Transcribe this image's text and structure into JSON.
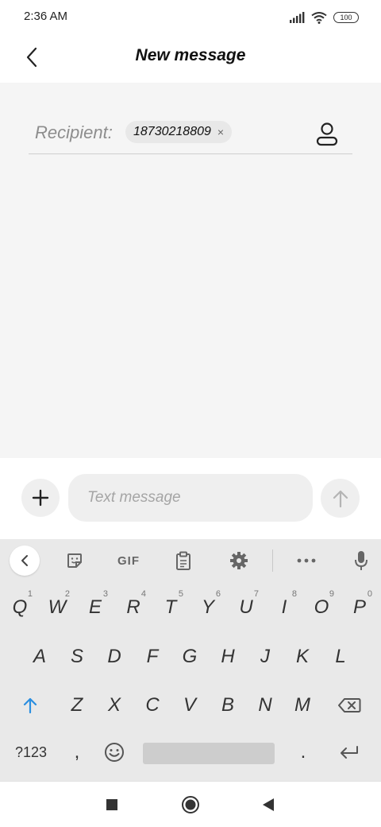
{
  "status_bar": {
    "time": "2:36 AM",
    "battery": "100",
    "icons": [
      "signal-icon",
      "wifi-icon",
      "battery-icon"
    ]
  },
  "header": {
    "title": "New message",
    "back_icon": "chevron-left-icon"
  },
  "recipient": {
    "label": "Recipient:",
    "chip_value": "18730218809",
    "chip_remove": "×",
    "contact_icon": "person-icon"
  },
  "compose": {
    "placeholder": "Text message",
    "add_icon": "plus-icon",
    "send_icon": "arrow-up-icon"
  },
  "keyboard": {
    "toolbar": {
      "gif_label": "GIF",
      "items": [
        "chevron-left-icon",
        "sticker-icon",
        "gif-icon",
        "clipboard-icon",
        "gear-icon",
        "more-icon",
        "microphone-icon"
      ]
    },
    "row1": [
      {
        "letter": "Q",
        "num": "1"
      },
      {
        "letter": "W",
        "num": "2"
      },
      {
        "letter": "E",
        "num": "3"
      },
      {
        "letter": "R",
        "num": "4"
      },
      {
        "letter": "T",
        "num": "5"
      },
      {
        "letter": "Y",
        "num": "6"
      },
      {
        "letter": "U",
        "num": "7"
      },
      {
        "letter": "I",
        "num": "8"
      },
      {
        "letter": "O",
        "num": "9"
      },
      {
        "letter": "P",
        "num": "0"
      }
    ],
    "row2": [
      "A",
      "S",
      "D",
      "F",
      "G",
      "H",
      "J",
      "K",
      "L"
    ],
    "row3": [
      "Z",
      "X",
      "C",
      "V",
      "B",
      "N",
      "M"
    ],
    "row4": {
      "symbols_label": "?123",
      "comma": ",",
      "period": "."
    },
    "accent_color": "#2b8fe0"
  },
  "nav_bar": {
    "items": [
      "recents-icon",
      "home-icon",
      "back-icon"
    ]
  }
}
